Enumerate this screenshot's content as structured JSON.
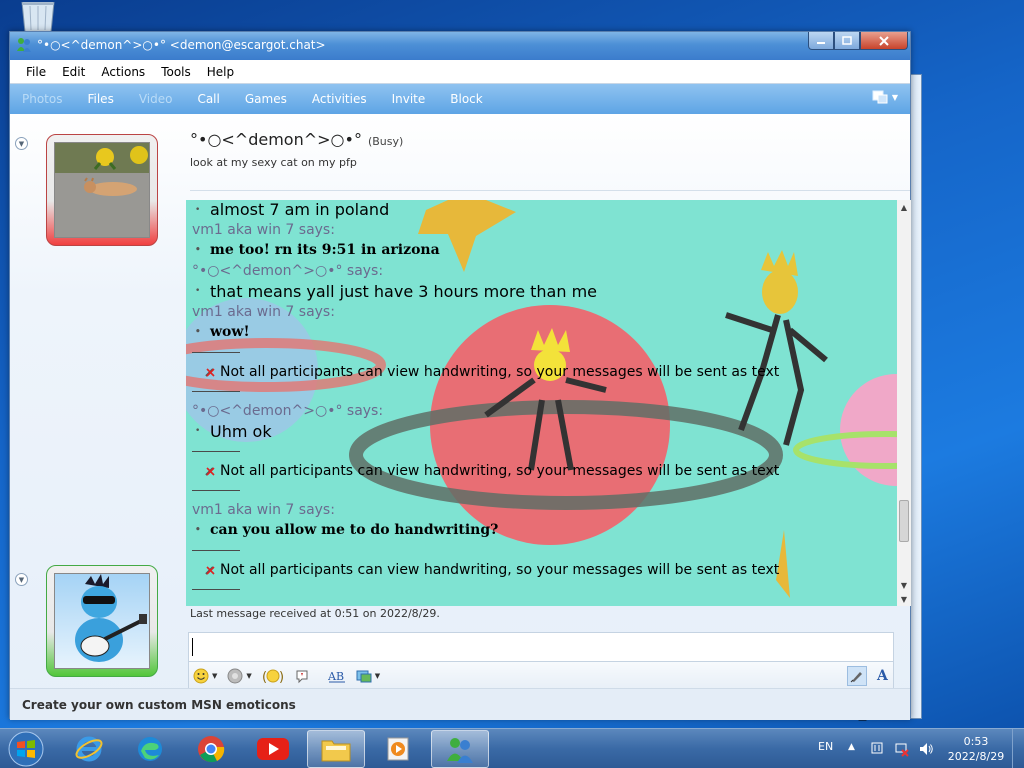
{
  "window": {
    "title": "°•○<^demon^>○•° <demon@escargot.chat>",
    "controls": {
      "minimize": "—",
      "maximize": "□",
      "close": "✕"
    }
  },
  "menu": [
    "File",
    "Edit",
    "Actions",
    "Tools",
    "Help"
  ],
  "toolbar": [
    {
      "label": "Photos",
      "enabled": false
    },
    {
      "label": "Files",
      "enabled": true
    },
    {
      "label": "Video",
      "enabled": false
    },
    {
      "label": "Call",
      "enabled": true
    },
    {
      "label": "Games",
      "enabled": true
    },
    {
      "label": "Activities",
      "enabled": true
    },
    {
      "label": "Invite",
      "enabled": true
    },
    {
      "label": "Block",
      "enabled": true
    }
  ],
  "contact": {
    "name": "°•○<^demon^>○•°",
    "status": "(Busy)",
    "personal_message": "look at my sexy cat on my pfp"
  },
  "conversation": {
    "partial_top": "almost 7 am in poland",
    "entries": [
      {
        "sender": "vm1 aka win 7 says:",
        "text": "me too! rn its 9:51 in arizona"
      },
      {
        "sender": "°•○<^demon^>○•° says:",
        "text": "that means yall just have 3 hours more than me"
      },
      {
        "sender": "vm1 aka win 7 says:",
        "text": "wow!"
      },
      {
        "system": "Not all participants can view handwriting, so your messages will be sent as text"
      },
      {
        "sender": "°•○<^demon^>○•° says:",
        "text": "Uhm ok"
      },
      {
        "system": "Not all participants can view handwriting, so your messages will be sent as text"
      },
      {
        "sender": "vm1 aka win 7 says:",
        "text": "can you allow me to do handwriting?"
      },
      {
        "system": "Not all participants can view handwriting, so your messages will be sent as text"
      }
    ]
  },
  "last_message": "Last message received at 0:51 on 2022/8/29.",
  "input": {
    "value": ""
  },
  "status_strip": "Create your own custom MSN emoticons",
  "taskbar": {
    "language": "EN",
    "time": "0:53",
    "date": "2022/8/29"
  },
  "colors": {
    "title_bar": "#4c8fd6",
    "toolbar": "#5ea5e5",
    "busy": "#f04040",
    "online": "#52c63a",
    "chat_background": "#7fe3d2"
  }
}
